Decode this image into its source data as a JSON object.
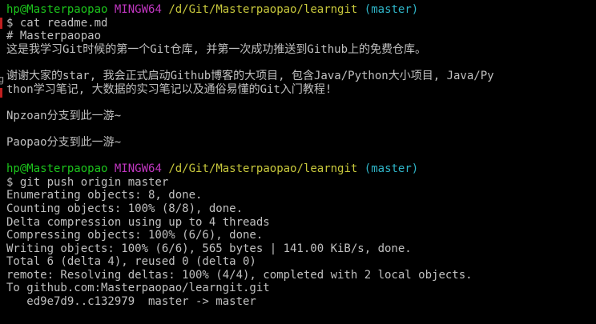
{
  "session1": {
    "prompt_user": "hp@Masterpaopao",
    "prompt_env": "MINGW64",
    "prompt_path": "/d/Git/Masterpaopao/learngit",
    "prompt_branch": "(master)",
    "command": "$ cat readme.md",
    "output": [
      "# Masterpaopao",
      "这是我学习Git时候的第一个Git仓库, 并第一次成功推送到Github上的免费仓库。",
      "",
      "谢谢大家的star, 我会正式启动Github博客的大项目, 包含Java/Python大小项目, Java/Py",
      "thon学习笔记, 大数据的实习笔记以及通俗易懂的Git入门教程!",
      "",
      "Npzoan分支到此一游~",
      "",
      "Paopao分支到此一游~",
      ""
    ]
  },
  "session2": {
    "prompt_user": "hp@Masterpaopao",
    "prompt_env": "MINGW64",
    "prompt_path": "/d/Git/Masterpaopao/learngit",
    "prompt_branch": "(master)",
    "command": "$ git push origin master",
    "output": [
      "Enumerating objects: 8, done.",
      "Counting objects: 100% (8/8), done.",
      "Delta compression using up to 4 threads",
      "Compressing objects: 100% (6/6), done.",
      "Writing objects: 100% (6/6), 565 bytes | 141.00 KiB/s, done.",
      "Total 6 (delta 4), reused 0 (delta 0)",
      "remote: Resolving deltas: 100% (4/4), completed with 2 local objects.",
      "To github.com:Masterpaopao/learngit.git",
      "   ed9e7d9..c132979  master -> master"
    ]
  },
  "colors": {
    "background": "#000000",
    "text": "#c0c0c0",
    "user": "#1cc51c",
    "env": "#c036c0",
    "path": "#c8c83c",
    "branch": "#2fb5c8"
  }
}
